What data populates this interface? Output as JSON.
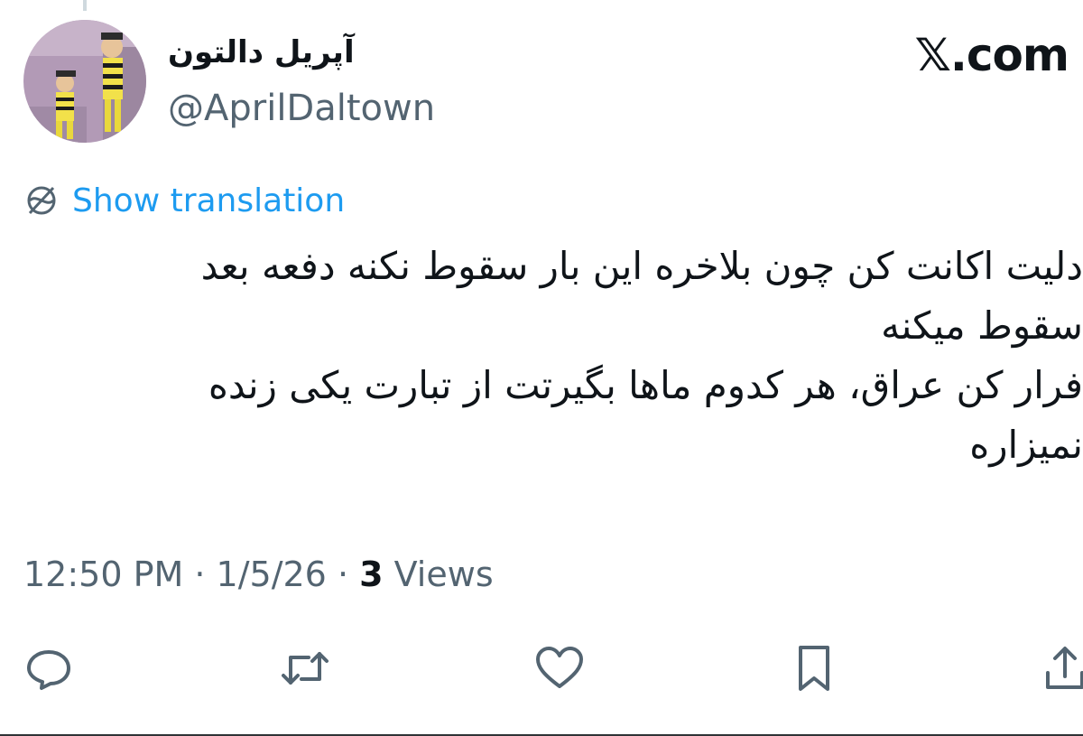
{
  "author": {
    "display_name": "آپریل دالتون",
    "handle": "@AprilDaltown"
  },
  "brand": "𝕏.com",
  "translate_label": "Show translation",
  "tweet": {
    "lines": [
      "دلیت اکانت کن چون بلاخره این بار سقوط نکنه دفعه بعد",
      "سقوط میکنه",
      "فرار کن عراق، هر کدوم ماها بگیرتت از تبارت یکی زنده",
      "نمیزاره"
    ]
  },
  "meta": {
    "time": "12:50 PM",
    "sep1": " · ",
    "date": "1/5/26",
    "sep2": " · ",
    "views_count": "3",
    "views_label": " Views"
  },
  "icons": {
    "reply": "reply-icon",
    "repost": "repost-icon",
    "like": "heart-icon",
    "bookmark": "bookmark-icon",
    "share": "share-icon",
    "translate": "translate-icon"
  },
  "colors": {
    "accent": "#1d9bf0",
    "secondary_text": "#536471",
    "primary_text": "#0f1419",
    "background": "#ffffff"
  }
}
